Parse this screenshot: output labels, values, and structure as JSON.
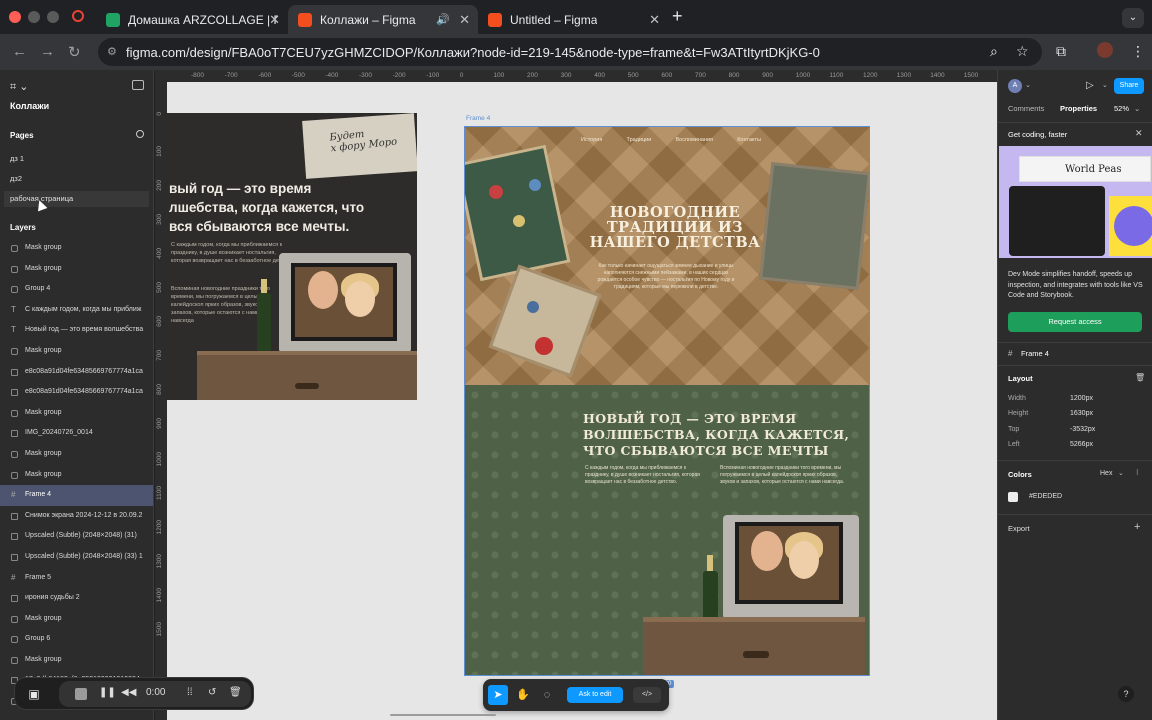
{
  "browser": {
    "tabs": [
      {
        "title": "Домашка ARZCOLLAGE | ПО",
        "favicon_color": "#1fa463"
      },
      {
        "title": "Коллажи – Figma",
        "favicon_color": "#f24e1e"
      },
      {
        "title": "Untitled – Figma",
        "favicon_color": "#f24e1e"
      }
    ],
    "new_tab": "+",
    "url": "figma.com/design/FBA0oT7CEU7yzGHMZCIDOP/Коллажи?node-id=219-145&node-type=frame&t=Fw3ATtItyrtDKjKG-0"
  },
  "left_panel": {
    "file_name": "Коллажи",
    "pages_title": "Pages",
    "pages": [
      "дз 1",
      "дз2",
      "рабочая страница"
    ],
    "layers_title": "Layers",
    "layers": [
      {
        "name": "Mask group",
        "kind": "mask"
      },
      {
        "name": "Mask group",
        "kind": "mask"
      },
      {
        "name": "Group 4",
        "kind": "mask"
      },
      {
        "name": "С каждым годом, когда мы приближ",
        "kind": "text"
      },
      {
        "name": "Новый год — это время волшебства",
        "kind": "text"
      },
      {
        "name": "Mask group",
        "kind": "mask"
      },
      {
        "name": "e8c08a91d04fe63485669767774a1ca",
        "kind": "image"
      },
      {
        "name": "e8c08a91d04fe63485669767774a1ca",
        "kind": "image"
      },
      {
        "name": "Mask group",
        "kind": "mask"
      },
      {
        "name": "IMG_20240726_0014",
        "kind": "image"
      },
      {
        "name": "Mask group",
        "kind": "mask"
      },
      {
        "name": "Mask group",
        "kind": "mask"
      },
      {
        "name": "Frame 4",
        "kind": "frame"
      },
      {
        "name": "Снимок экрана 2024-12-12 в 20.09.2",
        "kind": "image"
      },
      {
        "name": "Upscaled (Subtle) (2048×2048) (31)",
        "kind": "image"
      },
      {
        "name": "Upscaled (Subtle) (2048×2048) (33) 1",
        "kind": "image"
      },
      {
        "name": "Frame 5",
        "kind": "frame"
      },
      {
        "name": "ирония судьбы 2",
        "kind": "image"
      },
      {
        "name": "Mask group",
        "kind": "mask"
      },
      {
        "name": "Group 6",
        "kind": "mask"
      },
      {
        "name": "Mask group",
        "kind": "mask"
      },
      {
        "name": "17e9db84183ef6a253199991919804",
        "kind": "image"
      },
      {
        "name": "Mask group",
        "kind": "mask"
      }
    ]
  },
  "ruler": {
    "top": [
      "-800",
      "-700",
      "-600",
      "-500",
      "-400",
      "-300",
      "-200",
      "-100",
      "0",
      "100",
      "200",
      "300",
      "400",
      "500",
      "600",
      "700",
      "800",
      "900",
      "1000",
      "1100",
      "1200",
      "1300",
      "1400",
      "1500"
    ],
    "left": [
      "0",
      "100",
      "200",
      "300",
      "400",
      "500",
      "600",
      "700",
      "800",
      "900",
      "1000",
      "1100",
      "1200",
      "1300",
      "1400",
      "1500"
    ]
  },
  "collage_left": {
    "paper_text": "Будет\nх фору Моро",
    "title": "вый год — это время\nлшебства, когда кажется, что\nвся сбываются все мечты.",
    "para1": "С каждым годом, когда мы приближаемся к празднику, в душе возникает ностальгия, которая возвращает нас в беззаботное детство.",
    "para2": "Вспоминая новогодние праздники того времени, мы погружаемся в целый калейдоскоп ярких образов, звуков и запахов, которые остаются с нами навсегда"
  },
  "frame4": {
    "label": "Frame 4",
    "nav": [
      "История",
      "Традиции",
      "Воспоминания",
      "Контакты"
    ],
    "hero_title": "НОВОГОДНИЕ ТРАДИЦИИ ИЗ НАШЕГО ДЕТСТВА",
    "hero_text": "Как только начинает ощущаться зимнее дыхание и улицы наполняются снежными пейзажами, в наших сердцах рождается особое чувство — ностальгия по Новому году и традициям, которые мы пережили в детстве.",
    "bottom_title": "НОВЫЙ ГОД — ЭТО ВРЕМЯ ВОЛШЕБСТВА, КОГДА КАЖЕТСЯ, ЧТО СБЫВАЮТСЯ ВСЕ МЕЧТЫ",
    "bottom_p1": "С каждым годом, когда мы приближаемся к празднику, в душе возникает ностальгия, которая возвращает нас в беззаботное детство.",
    "bottom_p2": "Вспоминая новогодние праздники того времени, мы погружаемся в целый калейдоскоп ярких образов, звуков и запахов, которые остаются с нами навсегда.",
    "size_tag": "1630"
  },
  "canvas_toolbar": {
    "ask_label": "Ask to edit",
    "code_label": "</>"
  },
  "right_panel": {
    "avatar": "A",
    "share": "Share",
    "tabs": [
      "Comments",
      "Properties"
    ],
    "zoom": "52%",
    "promo_title": "Get coding, faster",
    "promo_brand": "World Peas",
    "promo_text": "Dev Mode simplifies handoff, speeds up inspection, and integrates with tools like VS Code and Storybook.",
    "request_btn": "Request access",
    "selection_name": "Frame 4",
    "layout_title": "Layout",
    "layout": [
      {
        "label": "Width",
        "value": "1200px"
      },
      {
        "label": "Height",
        "value": "1630px"
      },
      {
        "label": "Top",
        "value": "-3532px"
      },
      {
        "label": "Left",
        "value": "5266px"
      }
    ],
    "colors_title": "Colors",
    "color_format": "Hex",
    "color_value": "#EDEDED",
    "export_title": "Export"
  },
  "recorder": {
    "time": "0:00"
  },
  "help": "?"
}
